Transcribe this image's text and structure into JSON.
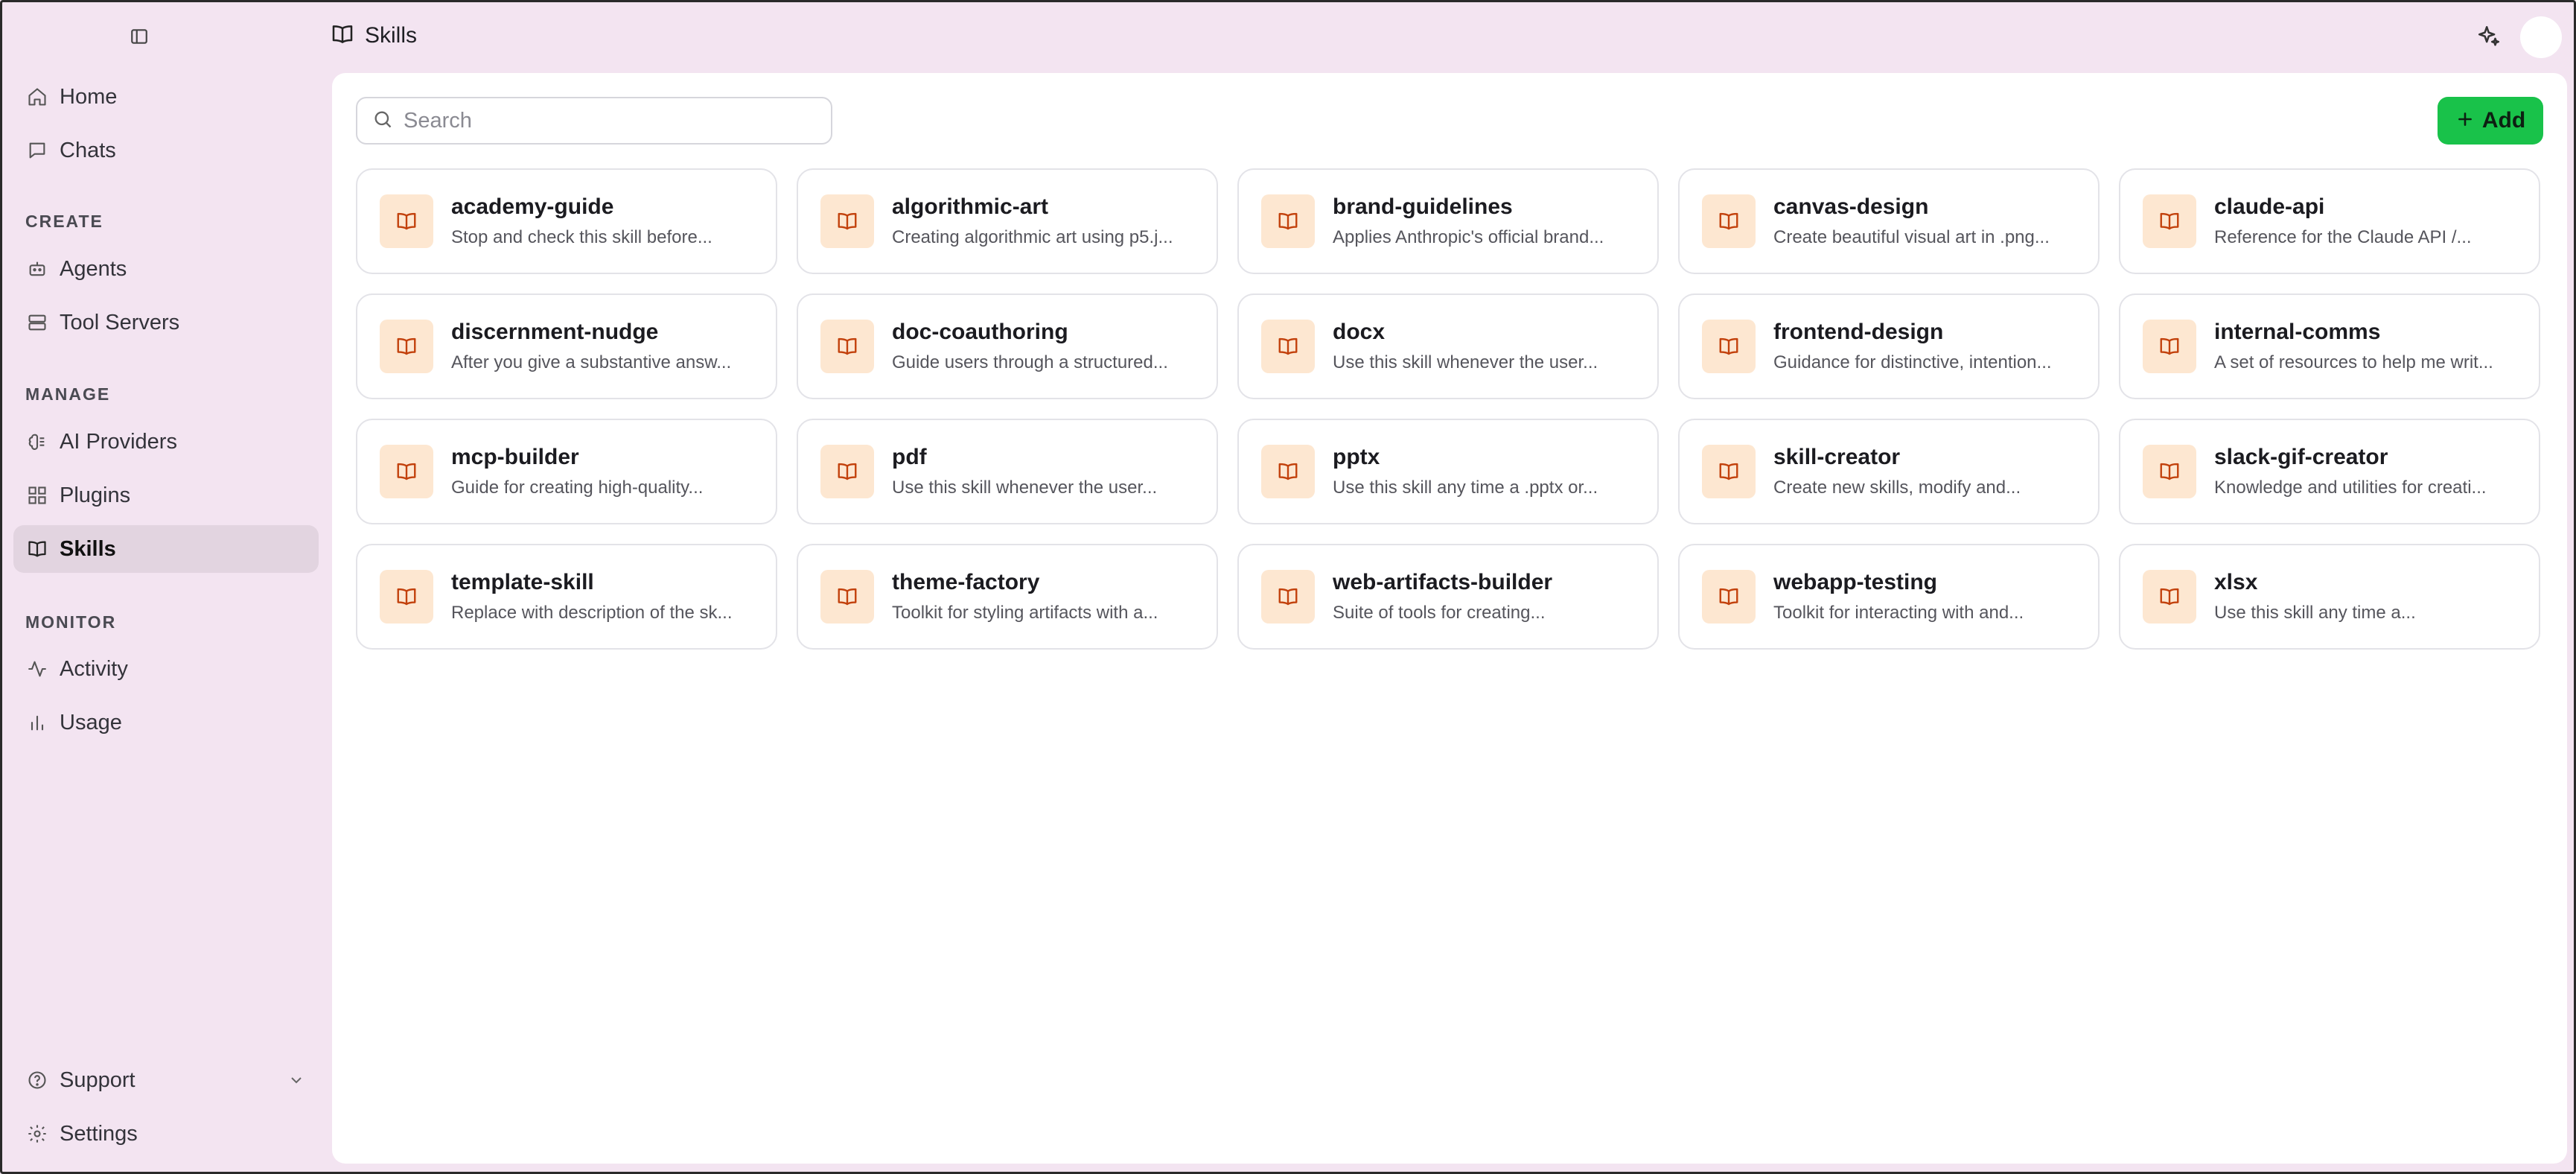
{
  "sidebar": {
    "items_top": [
      {
        "label": "Home",
        "icon": "home-icon"
      },
      {
        "label": "Chats",
        "icon": "chat-icon"
      }
    ],
    "sections": {
      "create": "CREATE",
      "manage": "MANAGE",
      "monitor": "MONITOR"
    },
    "create_items": [
      {
        "label": "Agents",
        "icon": "robot-icon"
      },
      {
        "label": "Tool Servers",
        "icon": "server-icon"
      }
    ],
    "manage_items": [
      {
        "label": "AI Providers",
        "icon": "brain-icon"
      },
      {
        "label": "Plugins",
        "icon": "plugin-icon"
      },
      {
        "label": "Skills",
        "icon": "book-icon",
        "active": true
      }
    ],
    "monitor_items": [
      {
        "label": "Activity",
        "icon": "activity-icon"
      },
      {
        "label": "Usage",
        "icon": "bar-chart-icon"
      }
    ],
    "bottom_items": [
      {
        "label": "Support",
        "icon": "help-circle-icon"
      },
      {
        "label": "Settings",
        "icon": "gear-icon"
      }
    ]
  },
  "header": {
    "title": "Skills"
  },
  "search": {
    "placeholder": "Search",
    "value": ""
  },
  "toolbar": {
    "add_label": "Add"
  },
  "colors": {
    "background": "#f3e4f1",
    "accent_green": "#19c24a",
    "badge_bg": "#fde7d1",
    "badge_icon": "#c2410c",
    "active_nav": "#e2d4e0"
  },
  "skills": [
    {
      "name": "academy-guide",
      "desc": "Stop and check this skill before..."
    },
    {
      "name": "algorithmic-art",
      "desc": "Creating algorithmic art using p5.j..."
    },
    {
      "name": "brand-guidelines",
      "desc": "Applies Anthropic's official brand..."
    },
    {
      "name": "canvas-design",
      "desc": "Create beautiful visual art in .png..."
    },
    {
      "name": "claude-api",
      "desc": "Reference for the Claude API /..."
    },
    {
      "name": "discernment-nudge",
      "desc": "After you give a substantive answ..."
    },
    {
      "name": "doc-coauthoring",
      "desc": "Guide users through a structured..."
    },
    {
      "name": "docx",
      "desc": "Use this skill whenever the user..."
    },
    {
      "name": "frontend-design",
      "desc": "Guidance for distinctive, intention..."
    },
    {
      "name": "internal-comms",
      "desc": "A set of resources to help me writ..."
    },
    {
      "name": "mcp-builder",
      "desc": "Guide for creating high-quality..."
    },
    {
      "name": "pdf",
      "desc": "Use this skill whenever the user..."
    },
    {
      "name": "pptx",
      "desc": "Use this skill any time a .pptx or..."
    },
    {
      "name": "skill-creator",
      "desc": "Create new skills, modify and..."
    },
    {
      "name": "slack-gif-creator",
      "desc": "Knowledge and utilities for creati..."
    },
    {
      "name": "template-skill",
      "desc": "Replace with description of the sk..."
    },
    {
      "name": "theme-factory",
      "desc": "Toolkit for styling artifacts with a..."
    },
    {
      "name": "web-artifacts-builder",
      "desc": "Suite of tools for creating..."
    },
    {
      "name": "webapp-testing",
      "desc": "Toolkit for interacting with and..."
    },
    {
      "name": "xlsx",
      "desc": "Use this skill any time a..."
    }
  ]
}
